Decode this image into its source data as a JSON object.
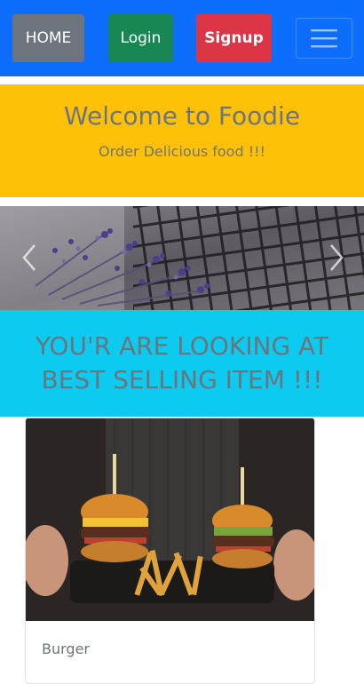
{
  "navbar": {
    "home_label": "HOME",
    "login_label": "Login",
    "signup_label": "Signup",
    "toggler_icon": "hamburger-menu-icon",
    "colors": {
      "background": "#0d6efd",
      "home": "#6c757d",
      "login": "#198754",
      "signup": "#dc3545"
    }
  },
  "welcome": {
    "title": "Welcome to Foodie",
    "subtitle": "Order Delicious food !!!",
    "background": "#ffc107"
  },
  "carousel": {
    "prev_icon": "chevron-left-icon",
    "next_icon": "chevron-right-icon"
  },
  "best_selling": {
    "heading": "YOU'R ARE LOOKING AT BEST SELLING ITEM !!!",
    "background": "#0dcaf0"
  },
  "card": {
    "title": "Burger"
  }
}
